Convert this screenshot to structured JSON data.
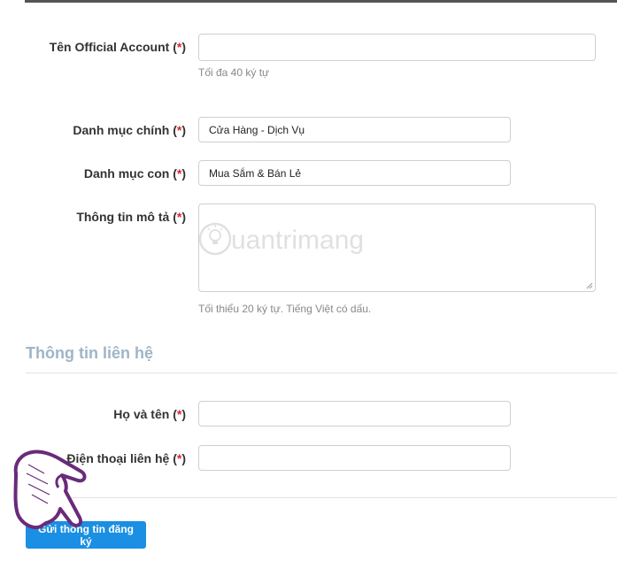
{
  "form": {
    "official_account": {
      "label": "Tên Official Account",
      "required_mark": "*",
      "value": "",
      "hint": "Tối đa 40 ký tự"
    },
    "main_category": {
      "label": "Danh mục chính",
      "required_mark": "*",
      "value": "Cửa Hàng - Dịch Vụ"
    },
    "sub_category": {
      "label": "Danh mục con",
      "required_mark": "*",
      "value": "Mua Sắm & Bán Lẻ"
    },
    "description": {
      "label": "Thông tin mô tả",
      "required_mark": "*",
      "value": "",
      "hint": "Tối thiểu 20 ký tự. Tiếng Việt có dấu."
    }
  },
  "contact": {
    "section_title": "Thông tin liên hệ",
    "full_name": {
      "label": "Họ và tên",
      "required_mark": "*",
      "value": ""
    },
    "phone": {
      "label": "Điện thoại liên hệ",
      "required_mark": "*",
      "value": ""
    }
  },
  "submit_label": "Gửi thông tin đăng ký",
  "watermark_text": "uantrimang",
  "colors": {
    "required": "#d9252a",
    "section_title": "#9fb4c8",
    "button": "#1a8fe3",
    "hint": "#888888",
    "border": "#cfcfcf"
  },
  "icons": {
    "watermark_logo": "bulb-icon",
    "pointer": "pointing-hand-icon"
  }
}
